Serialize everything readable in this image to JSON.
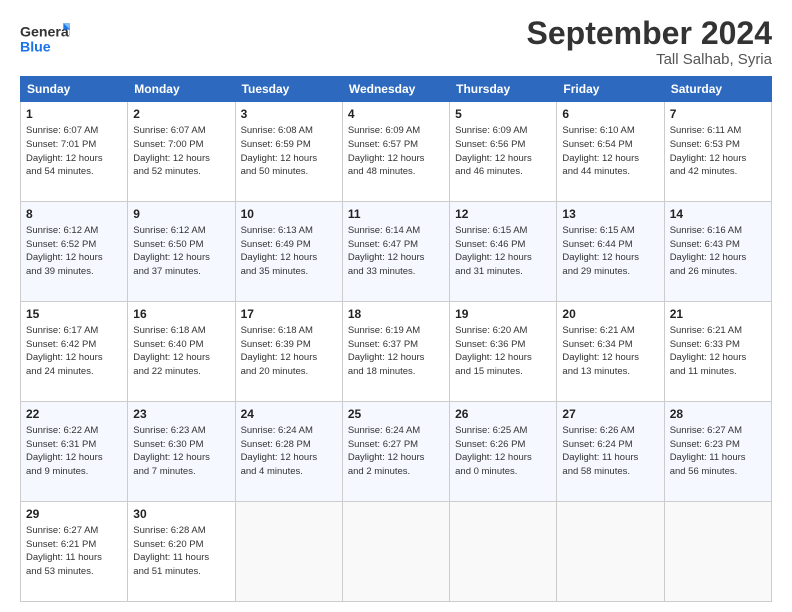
{
  "logo": {
    "line1": "General",
    "line2": "Blue"
  },
  "title": "September 2024",
  "location": "Tall Salhab, Syria",
  "headers": [
    "Sunday",
    "Monday",
    "Tuesday",
    "Wednesday",
    "Thursday",
    "Friday",
    "Saturday"
  ],
  "weeks": [
    [
      {
        "day": "1",
        "info": "Sunrise: 6:07 AM\nSunset: 7:01 PM\nDaylight: 12 hours\nand 54 minutes."
      },
      {
        "day": "2",
        "info": "Sunrise: 6:07 AM\nSunset: 7:00 PM\nDaylight: 12 hours\nand 52 minutes."
      },
      {
        "day": "3",
        "info": "Sunrise: 6:08 AM\nSunset: 6:59 PM\nDaylight: 12 hours\nand 50 minutes."
      },
      {
        "day": "4",
        "info": "Sunrise: 6:09 AM\nSunset: 6:57 PM\nDaylight: 12 hours\nand 48 minutes."
      },
      {
        "day": "5",
        "info": "Sunrise: 6:09 AM\nSunset: 6:56 PM\nDaylight: 12 hours\nand 46 minutes."
      },
      {
        "day": "6",
        "info": "Sunrise: 6:10 AM\nSunset: 6:54 PM\nDaylight: 12 hours\nand 44 minutes."
      },
      {
        "day": "7",
        "info": "Sunrise: 6:11 AM\nSunset: 6:53 PM\nDaylight: 12 hours\nand 42 minutes."
      }
    ],
    [
      {
        "day": "8",
        "info": "Sunrise: 6:12 AM\nSunset: 6:52 PM\nDaylight: 12 hours\nand 39 minutes."
      },
      {
        "day": "9",
        "info": "Sunrise: 6:12 AM\nSunset: 6:50 PM\nDaylight: 12 hours\nand 37 minutes."
      },
      {
        "day": "10",
        "info": "Sunrise: 6:13 AM\nSunset: 6:49 PM\nDaylight: 12 hours\nand 35 minutes."
      },
      {
        "day": "11",
        "info": "Sunrise: 6:14 AM\nSunset: 6:47 PM\nDaylight: 12 hours\nand 33 minutes."
      },
      {
        "day": "12",
        "info": "Sunrise: 6:15 AM\nSunset: 6:46 PM\nDaylight: 12 hours\nand 31 minutes."
      },
      {
        "day": "13",
        "info": "Sunrise: 6:15 AM\nSunset: 6:44 PM\nDaylight: 12 hours\nand 29 minutes."
      },
      {
        "day": "14",
        "info": "Sunrise: 6:16 AM\nSunset: 6:43 PM\nDaylight: 12 hours\nand 26 minutes."
      }
    ],
    [
      {
        "day": "15",
        "info": "Sunrise: 6:17 AM\nSunset: 6:42 PM\nDaylight: 12 hours\nand 24 minutes."
      },
      {
        "day": "16",
        "info": "Sunrise: 6:18 AM\nSunset: 6:40 PM\nDaylight: 12 hours\nand 22 minutes."
      },
      {
        "day": "17",
        "info": "Sunrise: 6:18 AM\nSunset: 6:39 PM\nDaylight: 12 hours\nand 20 minutes."
      },
      {
        "day": "18",
        "info": "Sunrise: 6:19 AM\nSunset: 6:37 PM\nDaylight: 12 hours\nand 18 minutes."
      },
      {
        "day": "19",
        "info": "Sunrise: 6:20 AM\nSunset: 6:36 PM\nDaylight: 12 hours\nand 15 minutes."
      },
      {
        "day": "20",
        "info": "Sunrise: 6:21 AM\nSunset: 6:34 PM\nDaylight: 12 hours\nand 13 minutes."
      },
      {
        "day": "21",
        "info": "Sunrise: 6:21 AM\nSunset: 6:33 PM\nDaylight: 12 hours\nand 11 minutes."
      }
    ],
    [
      {
        "day": "22",
        "info": "Sunrise: 6:22 AM\nSunset: 6:31 PM\nDaylight: 12 hours\nand 9 minutes."
      },
      {
        "day": "23",
        "info": "Sunrise: 6:23 AM\nSunset: 6:30 PM\nDaylight: 12 hours\nand 7 minutes."
      },
      {
        "day": "24",
        "info": "Sunrise: 6:24 AM\nSunset: 6:28 PM\nDaylight: 12 hours\nand 4 minutes."
      },
      {
        "day": "25",
        "info": "Sunrise: 6:24 AM\nSunset: 6:27 PM\nDaylight: 12 hours\nand 2 minutes."
      },
      {
        "day": "26",
        "info": "Sunrise: 6:25 AM\nSunset: 6:26 PM\nDaylight: 12 hours\nand 0 minutes."
      },
      {
        "day": "27",
        "info": "Sunrise: 6:26 AM\nSunset: 6:24 PM\nDaylight: 11 hours\nand 58 minutes."
      },
      {
        "day": "28",
        "info": "Sunrise: 6:27 AM\nSunset: 6:23 PM\nDaylight: 11 hours\nand 56 minutes."
      }
    ],
    [
      {
        "day": "29",
        "info": "Sunrise: 6:27 AM\nSunset: 6:21 PM\nDaylight: 11 hours\nand 53 minutes."
      },
      {
        "day": "30",
        "info": "Sunrise: 6:28 AM\nSunset: 6:20 PM\nDaylight: 11 hours\nand 51 minutes."
      },
      {
        "day": "",
        "info": ""
      },
      {
        "day": "",
        "info": ""
      },
      {
        "day": "",
        "info": ""
      },
      {
        "day": "",
        "info": ""
      },
      {
        "day": "",
        "info": ""
      }
    ]
  ]
}
